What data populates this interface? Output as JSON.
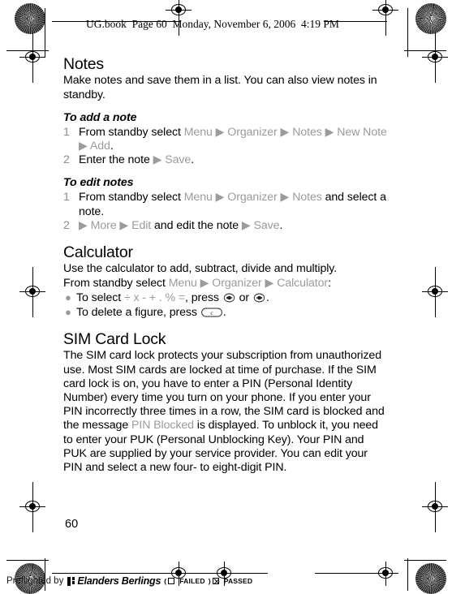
{
  "header": {
    "slug": "UG.book  Page 60  Monday, November 6, 2006  4:19 PM"
  },
  "page": {
    "number": "60"
  },
  "colors": {
    "menu_item_gray": "#9b9b9b",
    "step_number_gray": "#8c8c8c",
    "text_black": "#000000",
    "background": "#ffffff"
  },
  "sections": [
    {
      "id": "notes",
      "title": "Notes",
      "intro": "Make notes and save them in a list. You can also view notes in standby.",
      "subsections": [
        {
          "heading": "To add a note",
          "steps": [
            {
              "number": "1",
              "parts": [
                {
                  "t": "From standby select ",
                  "gray": false
                },
                {
                  "t": "Menu",
                  "gray": true
                },
                {
                  "t": " ▶ ",
                  "gray": true
                },
                {
                  "t": "Organizer",
                  "gray": true
                },
                {
                  "t": " ▶ ",
                  "gray": true
                },
                {
                  "t": "Notes",
                  "gray": true
                },
                {
                  "t": " ▶ ",
                  "gray": true
                },
                {
                  "t": "New Note",
                  "gray": true
                },
                {
                  "t": " ▶ ",
                  "gray": true
                },
                {
                  "t": "Add",
                  "gray": true
                },
                {
                  "t": ".",
                  "gray": false
                }
              ]
            },
            {
              "number": "2",
              "parts": [
                {
                  "t": "Enter the note ",
                  "gray": false
                },
                {
                  "t": "▶ ",
                  "gray": true
                },
                {
                  "t": "Save",
                  "gray": true
                },
                {
                  "t": ".",
                  "gray": false
                }
              ]
            }
          ]
        },
        {
          "heading": "To edit notes",
          "steps": [
            {
              "number": "1",
              "parts": [
                {
                  "t": "From standby select ",
                  "gray": false
                },
                {
                  "t": "Menu",
                  "gray": true
                },
                {
                  "t": " ▶ ",
                  "gray": true
                },
                {
                  "t": "Organizer",
                  "gray": true
                },
                {
                  "t": " ▶ ",
                  "gray": true
                },
                {
                  "t": "Notes",
                  "gray": true
                },
                {
                  "t": " and select a note.",
                  "gray": false
                }
              ]
            },
            {
              "number": "2",
              "parts": [
                {
                  "t": "▶ ",
                  "gray": true
                },
                {
                  "t": "More",
                  "gray": true
                },
                {
                  "t": " ▶ ",
                  "gray": true
                },
                {
                  "t": "Edit",
                  "gray": true
                },
                {
                  "t": " and edit the note ",
                  "gray": false
                },
                {
                  "t": "▶ ",
                  "gray": true
                },
                {
                  "t": "Save",
                  "gray": true
                },
                {
                  "t": ".",
                  "gray": false
                }
              ]
            }
          ]
        }
      ]
    },
    {
      "id": "calculator",
      "title": "Calculator",
      "intro": "Use the calculator to add, subtract, divide and multiply.",
      "path_line": [
        {
          "t": "From standby select ",
          "gray": false
        },
        {
          "t": "Menu",
          "gray": true
        },
        {
          "t": " ▶ ",
          "gray": true
        },
        {
          "t": "Organizer",
          "gray": true
        },
        {
          "t": " ▶ ",
          "gray": true
        },
        {
          "t": "Calculator",
          "gray": true
        },
        {
          "t": ":",
          "gray": false
        }
      ],
      "bullets": [
        {
          "parts": [
            {
              "t": "To select ",
              "gray": false
            },
            {
              "t": "÷ x - + . % =",
              "gray": true
            },
            {
              "t": ", press ",
              "gray": false
            }
          ],
          "icons": [
            {
              "name": "nav-key-left-icon",
              "after": " or "
            },
            {
              "name": "nav-key-right-icon",
              "after": "."
            }
          ]
        },
        {
          "parts": [
            {
              "t": "To delete a figure, press ",
              "gray": false
            }
          ],
          "icons": [
            {
              "name": "clear-key-icon",
              "label": "c",
              "after": "."
            }
          ]
        }
      ]
    },
    {
      "id": "sim-card-lock",
      "title": "SIM Card Lock",
      "body_parts": [
        {
          "t": "The SIM card lock protects your subscription from unauthorized use. Most SIM cards are locked at time of purchase. If the SIM card lock is on, you have to enter a PIN (Personal Identity Number) every time you turn on your phone. If you enter your PIN incorrectly three times in a row, the SIM card is blocked and the message ",
          "gray": false
        },
        {
          "t": "PIN Blocked",
          "gray": true
        },
        {
          "t": " is displayed. To unblock it, you need to enter your PUK (Personal Unblocking Key). Your PIN and PUK are supplied by your service provider. You can edit your PIN and select a new four- to eight-digit PIN.",
          "gray": false
        }
      ]
    }
  ],
  "footer": {
    "preflight_label": "Preflighted by",
    "brand": "Elanders Berlings",
    "failed_open_paren": "(",
    "failed_label": "FAILED",
    "failed_close_paren": ")",
    "passed_label": "PASSED"
  }
}
